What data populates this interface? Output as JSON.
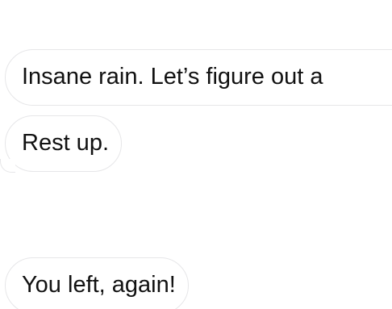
{
  "conversation": {
    "messages": [
      {
        "text": "Insane rain.  Let’s figure out a"
      },
      {
        "text": "Rest up."
      },
      {
        "text": "You left, again!"
      }
    ]
  }
}
